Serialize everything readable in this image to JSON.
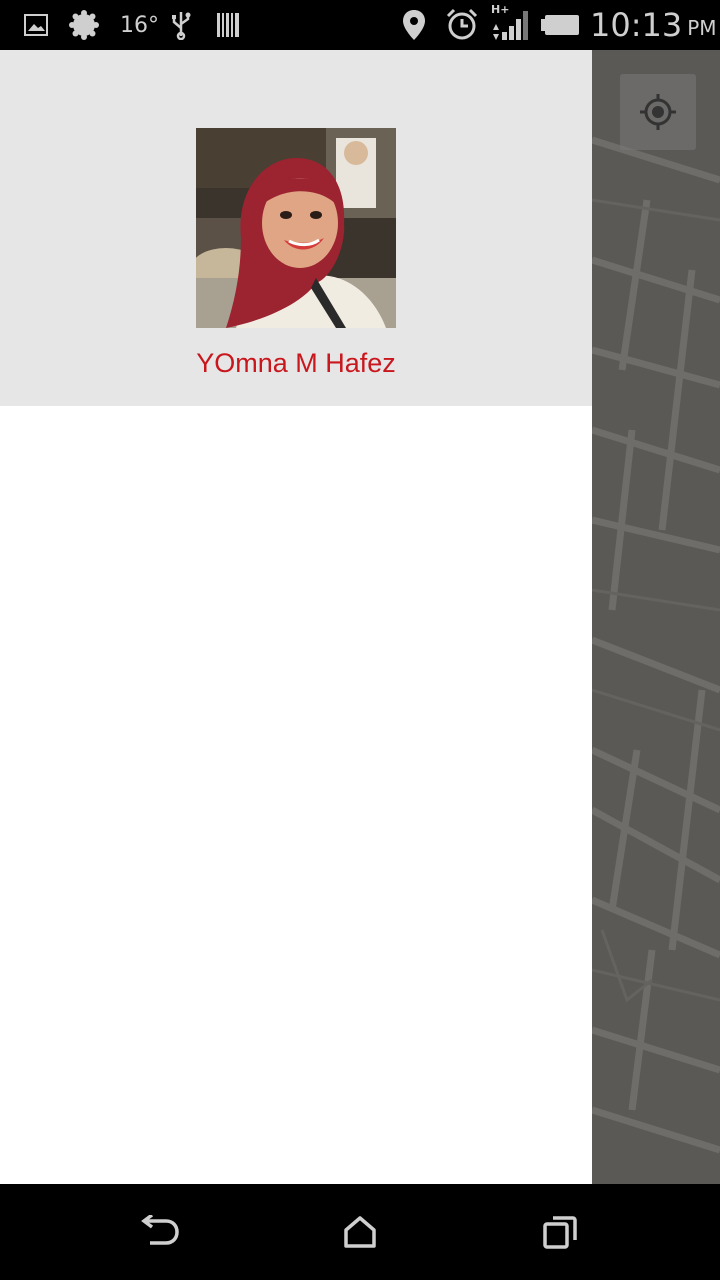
{
  "status_bar": {
    "temperature": "16°",
    "time": "10:13",
    "ampm": "PM",
    "network": "H+",
    "icons": [
      "gallery-icon",
      "weather-icon",
      "usb-icon",
      "barcode-icon",
      "location-pin-icon",
      "alarm-icon",
      "signal-icon",
      "battery-icon"
    ]
  },
  "drawer": {
    "user_name": "YOmna M Hafez",
    "header_color": "#e6e6e6",
    "name_color": "#c8171d"
  },
  "map": {
    "my_location_icon": "crosshair-icon"
  },
  "nav_bar": {
    "buttons": [
      "back-icon",
      "home-icon",
      "recents-icon"
    ]
  }
}
